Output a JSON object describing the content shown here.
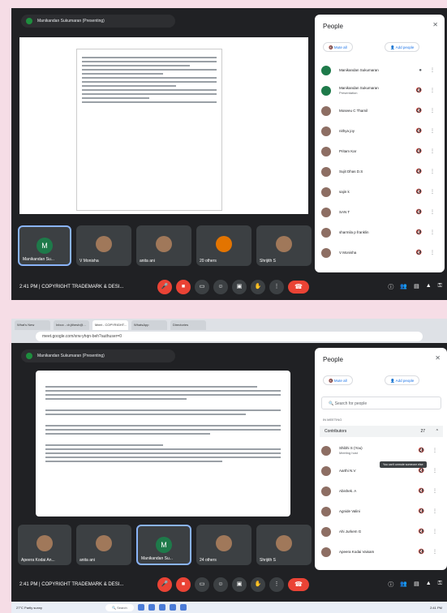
{
  "screen1": {
    "presenting": "Manikandan Sukumaran (Presenting)",
    "clock": "2:41 PM  |  COPYRIGHT TRADEMARK & DESI...",
    "tiles": [
      "Manikandan Su...",
      "V Monisha",
      "anita ani",
      "20 others",
      "Shrijith S"
    ],
    "tile_avatar_letters": [
      "M",
      "",
      "",
      "",
      ""
    ],
    "panel": {
      "title": "People",
      "mute_all": "Mute all",
      "add_people": "Add people",
      "people": [
        {
          "name": "Manikandan Sukumaran",
          "sub": ""
        },
        {
          "name": "Manikandan Sukumaran",
          "sub": "Presentation"
        },
        {
          "name": "Moseeu C Thamil",
          "sub": ""
        },
        {
          "name": "nithya joy",
          "sub": ""
        },
        {
          "name": "Pritam Kar",
          "sub": ""
        },
        {
          "name": "Sujit Dhas D.S",
          "sub": ""
        },
        {
          "name": "sajin k",
          "sub": ""
        },
        {
          "name": "SAN T",
          "sub": ""
        },
        {
          "name": "sharmila p franklin",
          "sub": ""
        },
        {
          "name": "V Monisha",
          "sub": ""
        }
      ]
    }
  },
  "screen2": {
    "tabs": [
      "What's New",
      "Inbox - dr.jithesh@...",
      "Meet - COPYRIGHT...",
      "WhatsApp",
      "Directories"
    ],
    "url": "meet.google.com/xrw-yhqn-beh?authuser=0",
    "presenting": "Manikandan Sukumaran (Presenting)",
    "clock": "2:41 PM  |  COPYRIGHT TRADEMARK & DESI...",
    "tiles": [
      "Apeera Kodai An...",
      "anita ani",
      "Manikandan Su...",
      "24 others",
      "Shrijith S"
    ],
    "tile_avatar_letters": [
      "",
      "",
      "M",
      "",
      ""
    ],
    "panel": {
      "title": "People",
      "mute_all": "Mute all",
      "add_people": "Add people",
      "search_placeholder": "Search for people",
      "section_label": "IN MEETING",
      "contributors_label": "Contributors",
      "contributors_count": "27",
      "tooltip": "You can't unmute someone else",
      "people": [
        {
          "name": "Shibhi S (You)",
          "sub": "Meeting host"
        },
        {
          "name": "Aarthi N.V",
          "sub": ""
        },
        {
          "name": "Abishek. A",
          "sub": ""
        },
        {
          "name": "Agnide Valini",
          "sub": ""
        },
        {
          "name": "Ahi Jurkem G",
          "sub": ""
        },
        {
          "name": "Apeera Kodai Vaisam",
          "sub": ""
        }
      ]
    },
    "taskbar": {
      "weather": "27°C  Partly sunny",
      "search": "Search",
      "time": "2:41 PM"
    }
  },
  "icons": {
    "mic": "mic-icon",
    "cam": "camera-icon",
    "hand": "hand-icon",
    "present": "present-icon",
    "more": "more-icon",
    "hangup": "hangup-icon"
  }
}
